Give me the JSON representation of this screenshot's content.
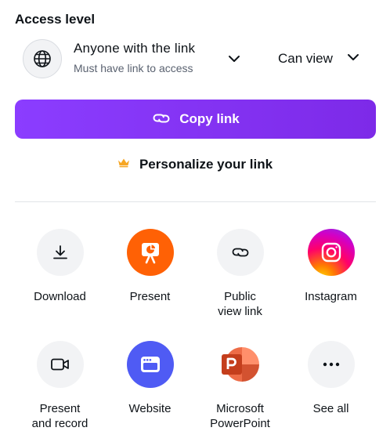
{
  "header": {
    "title": "Access level"
  },
  "access": {
    "main": "Anyone with the link",
    "sub": "Must have link to access",
    "permission": "Can view"
  },
  "copy_button": {
    "label": "Copy link"
  },
  "personalize": {
    "label": "Personalize your link"
  },
  "share_options": [
    {
      "label": "Download",
      "icon": "download-icon"
    },
    {
      "label": "Present",
      "icon": "present-icon",
      "color": "#ff6105"
    },
    {
      "label": "Public\nview link",
      "icon": "link-icon"
    },
    {
      "label": "Instagram",
      "icon": "instagram-icon"
    },
    {
      "label": "Present\nand record",
      "icon": "video-camera-icon"
    },
    {
      "label": "Website",
      "icon": "website-icon",
      "color": "#4f5bf4"
    },
    {
      "label": "Microsoft\nPowerPoint",
      "icon": "powerpoint-icon",
      "color": "#c43e1c"
    },
    {
      "label": "See all",
      "icon": "more-icon"
    }
  ],
  "colors": {
    "primary": "#8b3dff",
    "crown": "#f6a623"
  }
}
